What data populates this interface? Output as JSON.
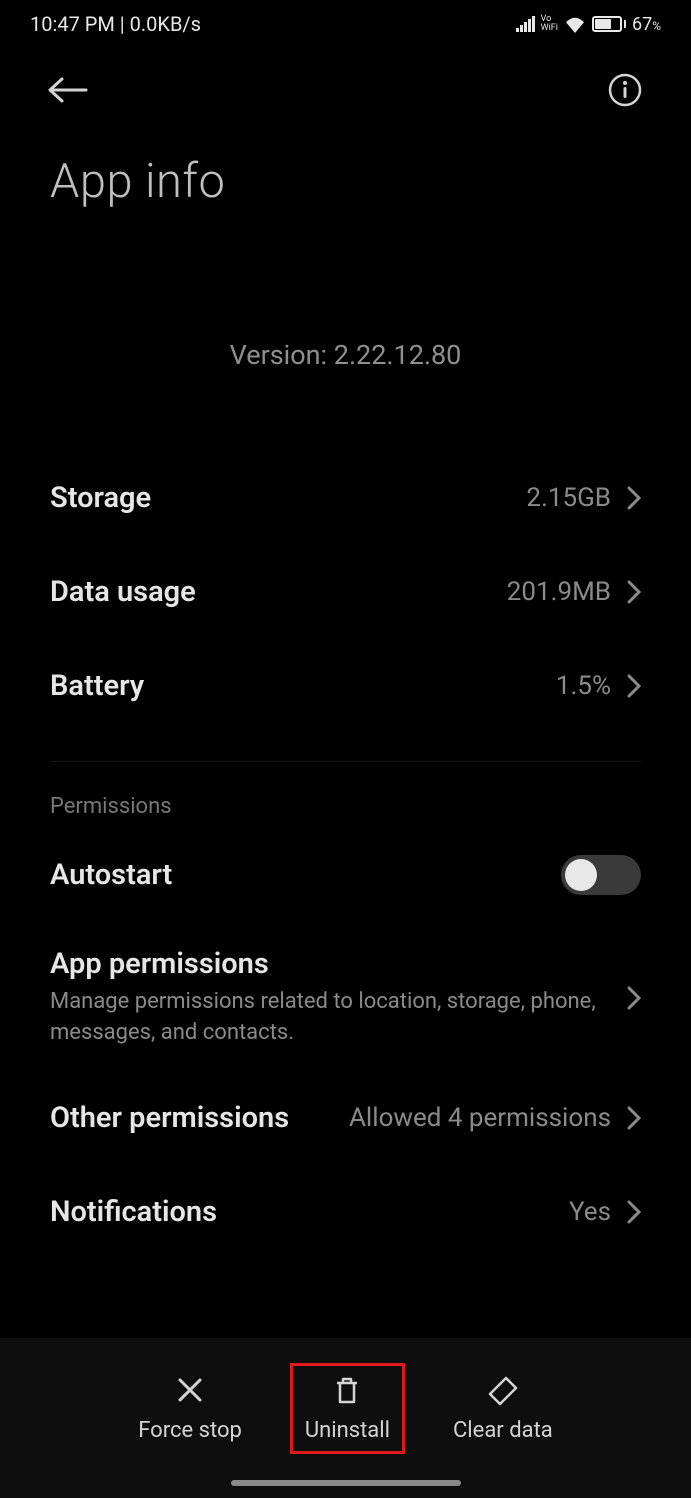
{
  "status": {
    "time": "10:47 PM",
    "speed": "0.0KB/s",
    "vowifi_top": "Vo",
    "vowifi_bottom": "WiFi",
    "battery_pct": "67",
    "battery_pct_suffix": "%"
  },
  "header": {
    "title": "App info"
  },
  "app": {
    "version_label": "Version: 2.22.12.80"
  },
  "rows": {
    "storage": {
      "label": "Storage",
      "value": "2.15GB"
    },
    "data_usage": {
      "label": "Data usage",
      "value": "201.9MB"
    },
    "battery": {
      "label": "Battery",
      "value": "1.5%"
    }
  },
  "permissions": {
    "header": "Permissions",
    "autostart": {
      "label": "Autostart",
      "enabled": false
    },
    "app_permissions": {
      "label": "App permissions",
      "sub": "Manage permissions related to location, storage, phone, messages, and contacts."
    },
    "other_permissions": {
      "label": "Other permissions",
      "value": "Allowed 4 permissions"
    },
    "notifications": {
      "label": "Notifications",
      "value": "Yes"
    }
  },
  "bottom": {
    "force_stop": "Force stop",
    "uninstall": "Uninstall",
    "clear_data": "Clear data"
  }
}
